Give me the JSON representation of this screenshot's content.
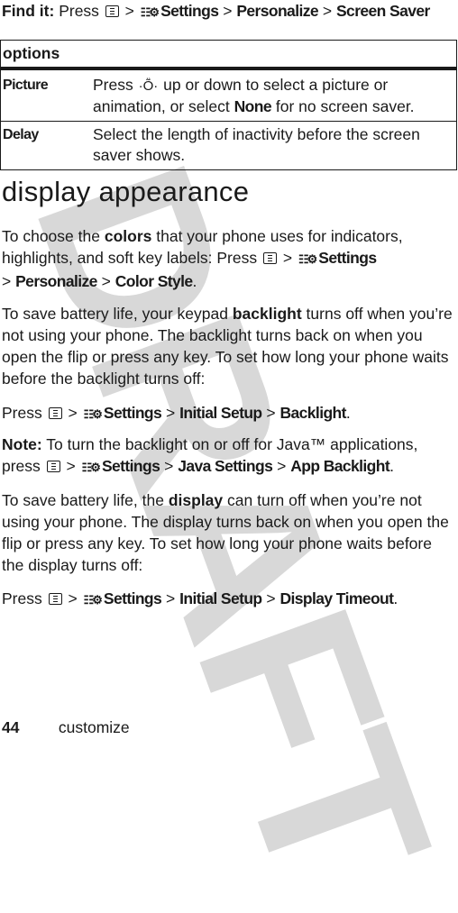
{
  "watermark": "DRAFT",
  "find_it": {
    "label": "Find it:",
    "press": "Press",
    "sep": ">",
    "path": [
      "Settings",
      "Personalize",
      "Screen Saver"
    ]
  },
  "options_table": {
    "header": "options",
    "rows": [
      {
        "name": "Picture",
        "desc_before": "Press",
        "desc_middle": "up or down to select a picture or animation, or select",
        "desc_bold": "None",
        "desc_after": "for no screen saver."
      },
      {
        "name": "Delay",
        "desc": "Select the length of inactivity before the screen saver shows."
      }
    ]
  },
  "section_title": "display appearance",
  "paragraphs": {
    "colors": {
      "before": "To choose the",
      "bold": "colors",
      "after": "that your phone uses for indicators, highlights, and soft key labels: Press",
      "path": [
        "Settings",
        "Personalize",
        "Color Style"
      ]
    },
    "backlight": {
      "before": "To save battery life, your keypad",
      "bold": "backlight",
      "after": "turns off when you’re not using your phone. The backlight turns back on when you open the flip or press any key. To set how long your phone waits before the backlight turns off:"
    },
    "backlight_path": {
      "press": "Press",
      "path": [
        "Settings",
        "Initial Setup",
        "Backlight"
      ]
    },
    "note": {
      "label": "Note:",
      "text": "To turn the backlight on or off for Java™ applications, press",
      "path": [
        "Settings",
        "Java Settings",
        "App Backlight"
      ]
    },
    "display": {
      "before": "To save battery life, the",
      "bold": "display",
      "after": "can turn off when you’re not using your phone. The display turns back on when you open the flip or press any key. To set how long your phone waits before the display turns off:"
    },
    "display_path": {
      "press": "Press",
      "path": [
        "Settings",
        "Initial Setup",
        "Display Timeout"
      ]
    }
  },
  "footer": {
    "page_number": "44",
    "section": "customize"
  },
  "icons": {
    "menu_key": "menu-key-icon",
    "settings": "settings-icon",
    "nav_key": "navigation-key-icon"
  },
  "period": "."
}
